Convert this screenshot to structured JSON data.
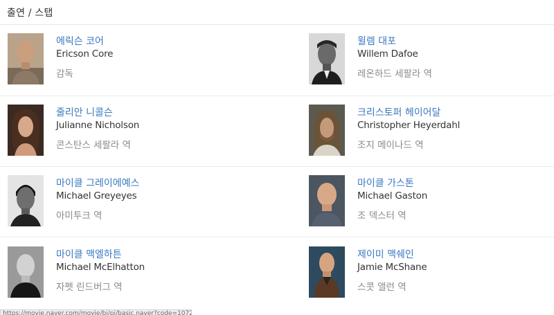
{
  "section": {
    "title": "출연 / 스탭"
  },
  "people": [
    {
      "name_ko": "에릭슨 코어",
      "name_en": "Ericson Core",
      "role": "감독"
    },
    {
      "name_ko": "윌렘 대포",
      "name_en": "Willem Dafoe",
      "role": "레온하드 세팔라 역"
    },
    {
      "name_ko": "줄리안 니콜슨",
      "name_en": "Julianne Nicholson",
      "role": "콘스탄스 세팔라 역"
    },
    {
      "name_ko": "크리스토퍼 헤이어달",
      "name_en": "Christopher Heyerdahl",
      "role": "조지 메이나드 역"
    },
    {
      "name_ko": "마이클 그레이에예스",
      "name_en": "Michael Greyeyes",
      "role": "아미투크 역"
    },
    {
      "name_ko": "마이클 가스톤",
      "name_en": "Michael Gaston",
      "role": "조 덱스터 역"
    },
    {
      "name_ko": "마이클 맥엘하튼",
      "name_en": "Michael McElhatton",
      "role": "자펫 린드버그 역"
    },
    {
      "name_ko": "제이미 맥쉐인",
      "name_en": "Jamie McShane",
      "role": "스콧 앨런 역"
    }
  ],
  "status_bar": {
    "url": "https://movie.naver.com/movie/bi/pi/basic.naver?code=107211"
  },
  "colors": {
    "link": "#3a78c2",
    "text": "#333333",
    "role": "#8a8a8a",
    "divider": "#ececec"
  }
}
